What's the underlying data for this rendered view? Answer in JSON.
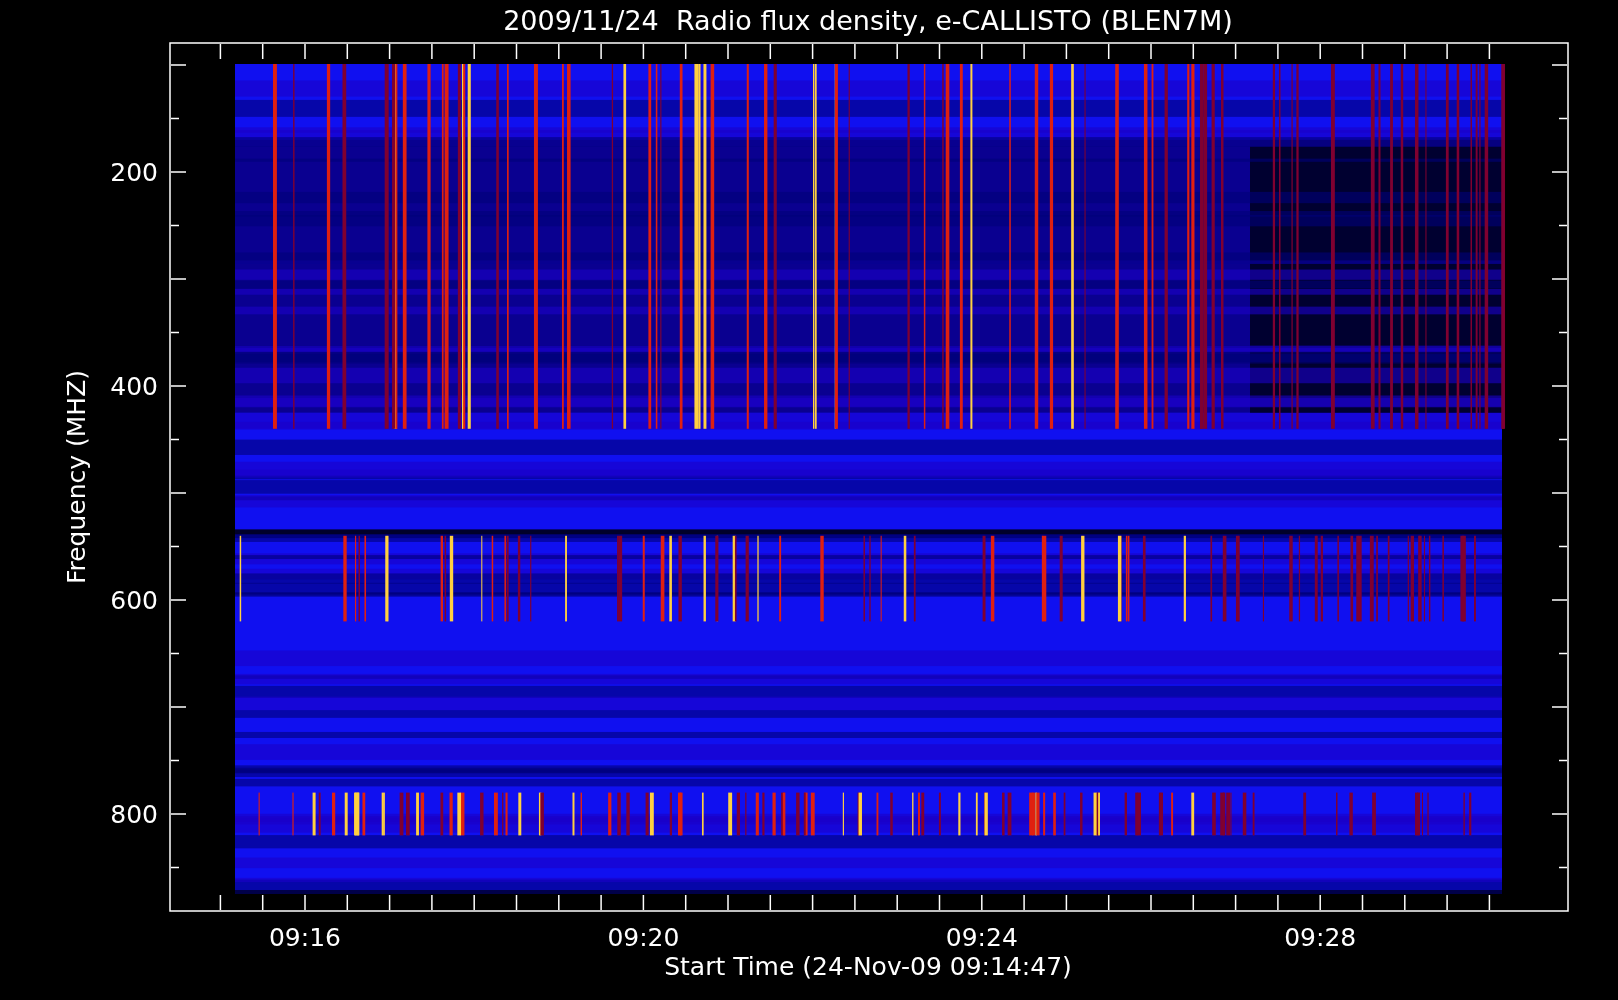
{
  "title": "2009/11/24  Radio flux density, e-CALLISTO (BLEN7M)",
  "y_axis": {
    "label": "Frequency (MHZ)",
    "ticks": [
      "200",
      "400",
      "600",
      "800"
    ]
  },
  "x_axis": {
    "label": "Start Time (24-Nov-09 09:14:47)",
    "ticks": [
      "09:16",
      "09:20",
      "09:24",
      "09:28"
    ]
  }
}
